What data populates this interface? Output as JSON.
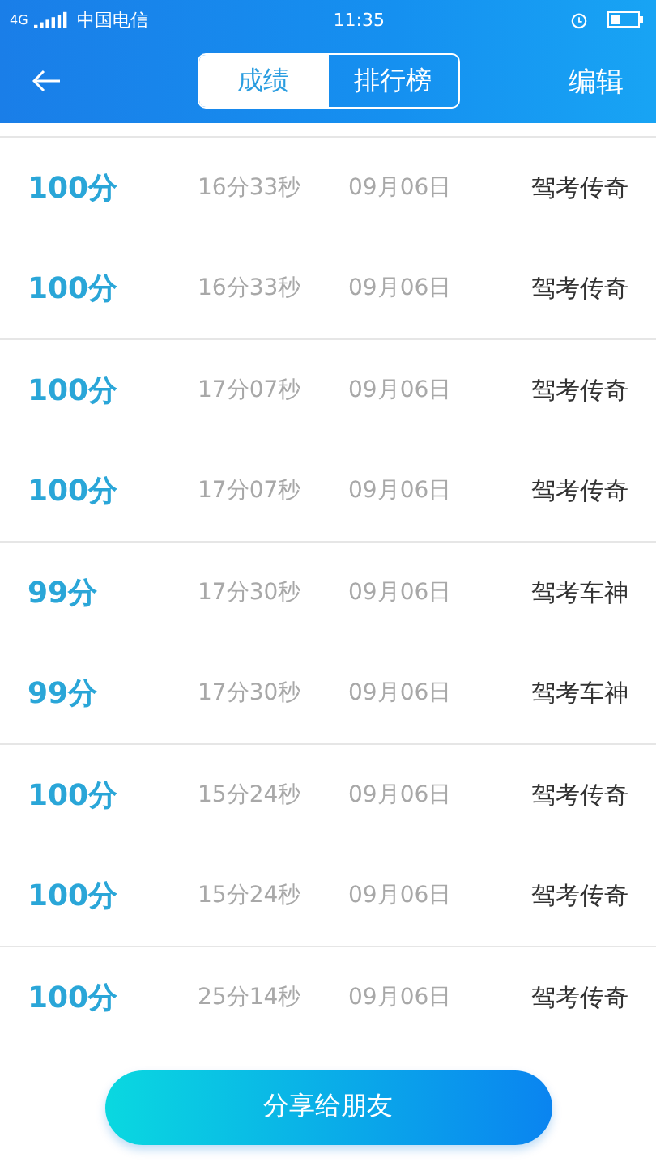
{
  "status_bar": {
    "network": "4G",
    "carrier": "中国电信",
    "time": "11:35"
  },
  "header": {
    "tabs": [
      {
        "label": "成绩",
        "selected": true
      },
      {
        "label": "排行榜",
        "selected": false
      }
    ],
    "action": "编辑"
  },
  "groups": [
    {
      "records": [
        {
          "score": "100分",
          "duration": "16分33秒",
          "date": "09月06日",
          "nickname": "驾考传奇"
        },
        {
          "score": "100分",
          "duration": "16分33秒",
          "date": "09月06日",
          "nickname": "驾考传奇"
        }
      ]
    },
    {
      "records": [
        {
          "score": "100分",
          "duration": "17分07秒",
          "date": "09月06日",
          "nickname": "驾考传奇"
        },
        {
          "score": "100分",
          "duration": "17分07秒",
          "date": "09月06日",
          "nickname": "驾考传奇"
        }
      ]
    },
    {
      "records": [
        {
          "score": "99分",
          "duration": "17分30秒",
          "date": "09月06日",
          "nickname": "驾考车神"
        },
        {
          "score": "99分",
          "duration": "17分30秒",
          "date": "09月06日",
          "nickname": "驾考车神"
        }
      ]
    },
    {
      "records": [
        {
          "score": "100分",
          "duration": "15分24秒",
          "date": "09月06日",
          "nickname": "驾考传奇"
        },
        {
          "score": "100分",
          "duration": "15分24秒",
          "date": "09月06日",
          "nickname": "驾考传奇"
        }
      ]
    },
    {
      "records": [
        {
          "score": "100分",
          "duration": "25分14秒",
          "date": "09月06日",
          "nickname": "驾考传奇"
        }
      ]
    }
  ],
  "share_button": "分享给朋友"
}
